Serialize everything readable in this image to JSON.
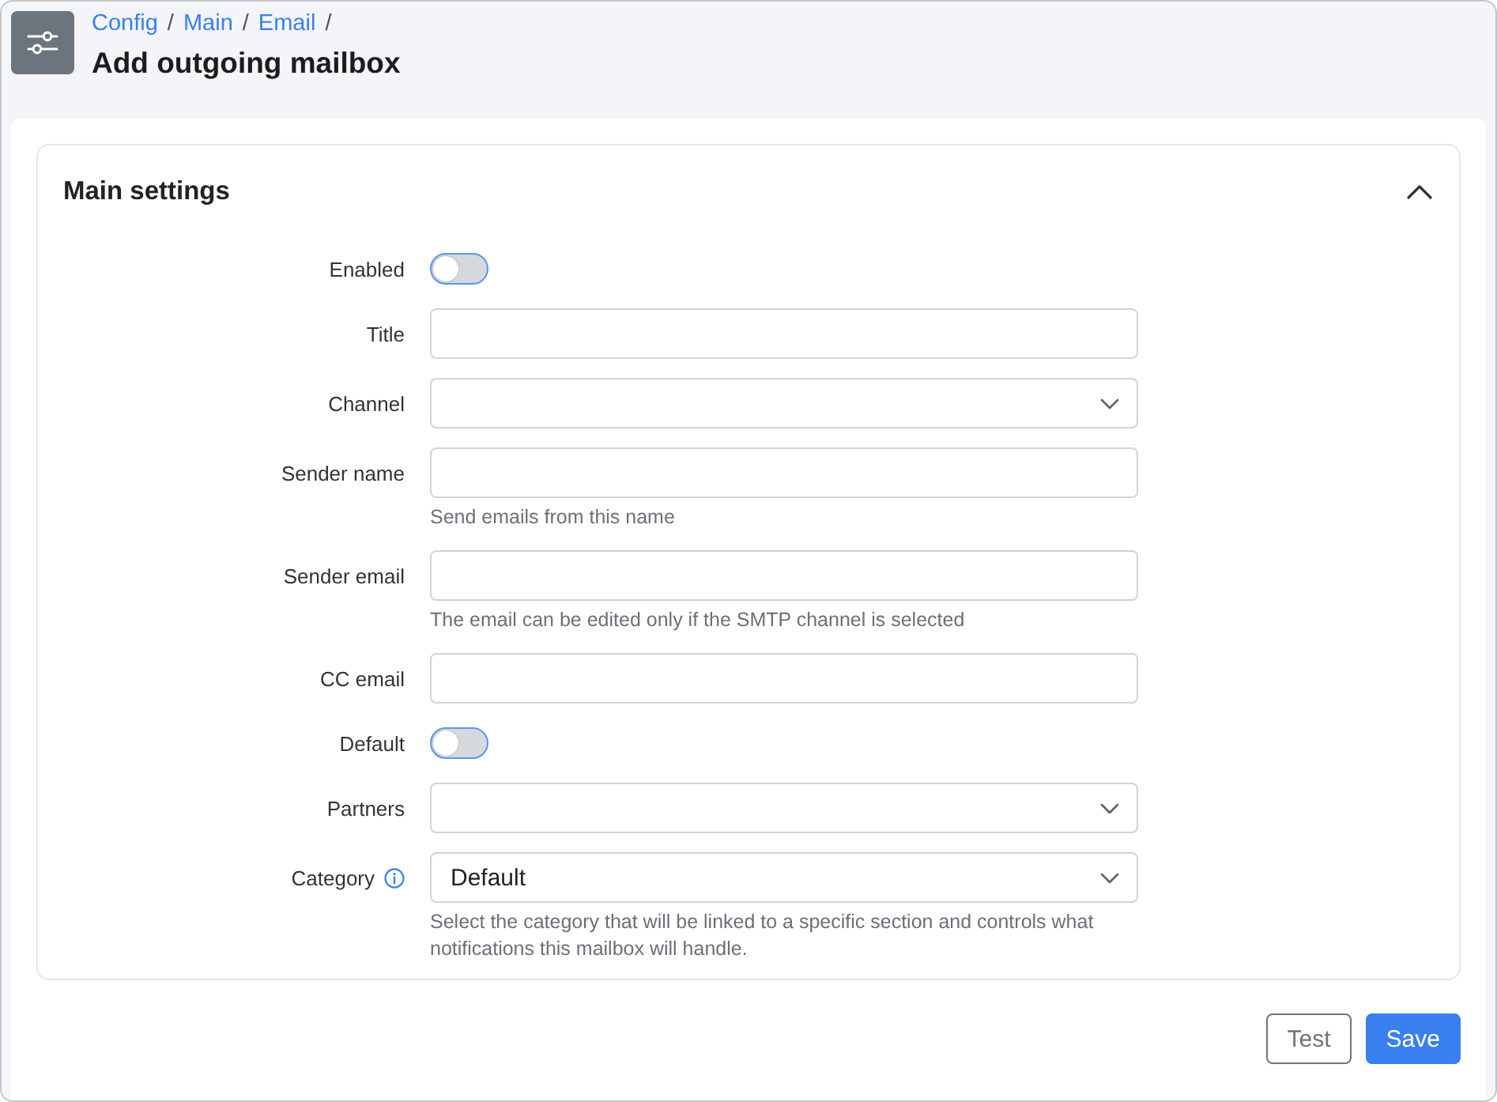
{
  "breadcrumb": {
    "items": [
      "Config",
      "Main",
      "Email"
    ],
    "separator": "/"
  },
  "page_title": "Add outgoing mailbox",
  "section": {
    "title": "Main settings",
    "expanded": true,
    "fields": [
      {
        "kind": "toggle",
        "label": "Enabled",
        "on": false
      },
      {
        "kind": "input",
        "label": "Title"
      },
      {
        "kind": "select",
        "label": "Channel"
      },
      {
        "kind": "input",
        "label": "Sender name",
        "hint": "Send emails from this name"
      },
      {
        "kind": "input",
        "label": "Sender email",
        "hint": "The email can be edited only if the SMTP channel is selected"
      },
      {
        "kind": "input",
        "label": "CC email"
      },
      {
        "kind": "toggle",
        "label": "Default",
        "on": false
      },
      {
        "kind": "select",
        "label": "Partners"
      },
      {
        "kind": "select",
        "label": "Category",
        "info": true,
        "value": "Default",
        "hint": "Select the category that will be linked to a specific section and controls what notifications this mailbox will handle."
      }
    ]
  },
  "buttons": [
    {
      "label": "Test",
      "kind": "secondary"
    },
    {
      "label": "Save",
      "kind": "primary"
    }
  ]
}
